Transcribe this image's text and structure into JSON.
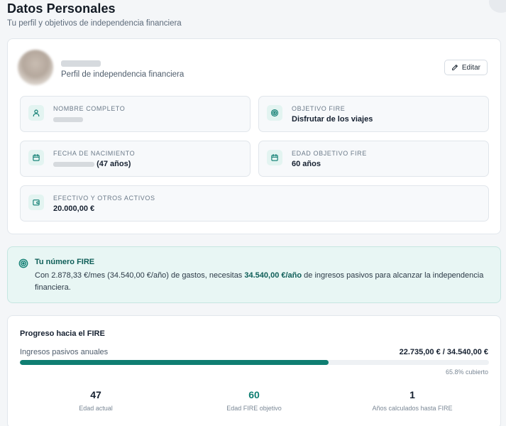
{
  "header": {
    "title": "Datos Personales",
    "subtitle": "Tu perfil y objetivos de independencia financiera"
  },
  "profile": {
    "subtitle": "Perfil de independencia financiera",
    "edit_label": "Editar"
  },
  "fields": {
    "full_name": {
      "label": "Nombre completo",
      "icon": "user-icon"
    },
    "fire_goal": {
      "label": "Objetivo FIRE",
      "value": "Disfrutar de los viajes",
      "icon": "target-icon"
    },
    "birth_date": {
      "label": "Fecha de nacimiento",
      "age": "(47 años)",
      "icon": "calendar-icon"
    },
    "target_age": {
      "label": "Edad objetivo FIRE",
      "value": "60 años",
      "icon": "calendar-icon"
    },
    "cash_assets": {
      "label": "Efectivo y otros activos",
      "value": "20.000,00 €",
      "icon": "wallet-icon"
    }
  },
  "fire_number": {
    "title": "Tu número FIRE",
    "text_before": "Con 2.878,33 €/mes (34.540,00 €/año) de gastos, necesitas ",
    "highlight": "34.540,00 €/año",
    "text_after": " de ingresos pasivos para alcanzar la independencia financiera."
  },
  "progress": {
    "title": "Progreso hacia el FIRE",
    "label": "Ingresos pasivos anuales",
    "amounts": "22.735,00 € / 34.540,00 €",
    "percent": 65.8,
    "percent_text": "65.8% cubierto"
  },
  "stats": [
    {
      "value": "47",
      "label": "Edad actual"
    },
    {
      "value": "60",
      "label": "Edad FIRE objetivo"
    },
    {
      "value": "1",
      "label": "Años calculados hasta FIRE"
    }
  ],
  "colors": {
    "accent": "#0f7e72",
    "accent_bg": "#e8f6f4",
    "icon_bg": "#e3f4f1"
  }
}
